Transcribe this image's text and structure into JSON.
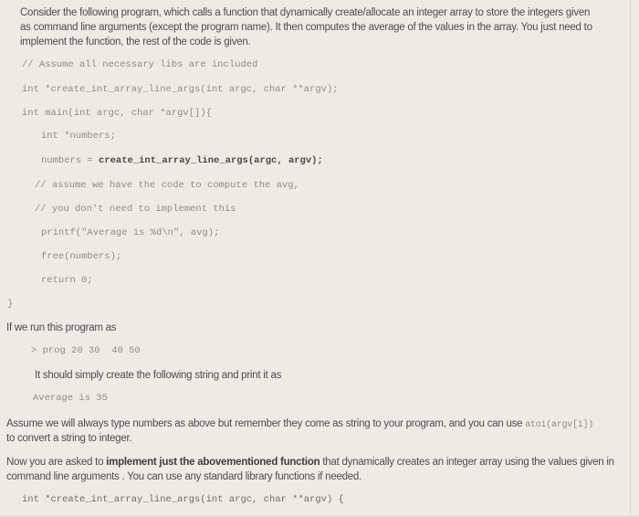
{
  "intro": {
    "line1": "Consider the following program, which calls a function that dynamically create/allocate an integer array to store the integers given",
    "line2": "as command line arguments (except the program name).  It then computes the average of the values in the array. You just need to",
    "line3": "implement the function, the rest of the code is given."
  },
  "code": {
    "comment_libs": "// Assume all necessary libs are included",
    "prototype": "int *create_int_array_line_args(int argc, char **argv);",
    "main_sig": "int main(int argc, char *argv[]){",
    "decl": "int *numbers;",
    "assign_lhs": "numbers = ",
    "assign_call": "create_int_array_line_args(argc, argv);",
    "comment_avg1": "// assume we have the code to compute the avg,",
    "comment_avg2": "// you don't need to implement this",
    "printf": "printf(\"Average is %d\\n\", avg);",
    "free": "free(numbers);",
    "return": "return 0;",
    "close": "}"
  },
  "run": {
    "intro": "If we run this program as",
    "command": "> prog 20 30  40 50",
    "explain": "It should simply create the following string and print it as",
    "output": "Average is 35"
  },
  "note": {
    "line1_text": "Assume we will always type numbers as above but remember they come as string to your program, and you can use ",
    "line1_code": "atoi(argv[i])",
    "line2": "to convert a string to integer."
  },
  "task": {
    "prefix": "Now you are asked to ",
    "bold": "implement just the abovementioned function",
    "suffix": " that dynamically creates an integer array using the values given in",
    "line2": "command line arguments . You can use any standard library functions if needed.",
    "signature": "int *create_int_array_line_args(int argc, char **argv) {"
  }
}
